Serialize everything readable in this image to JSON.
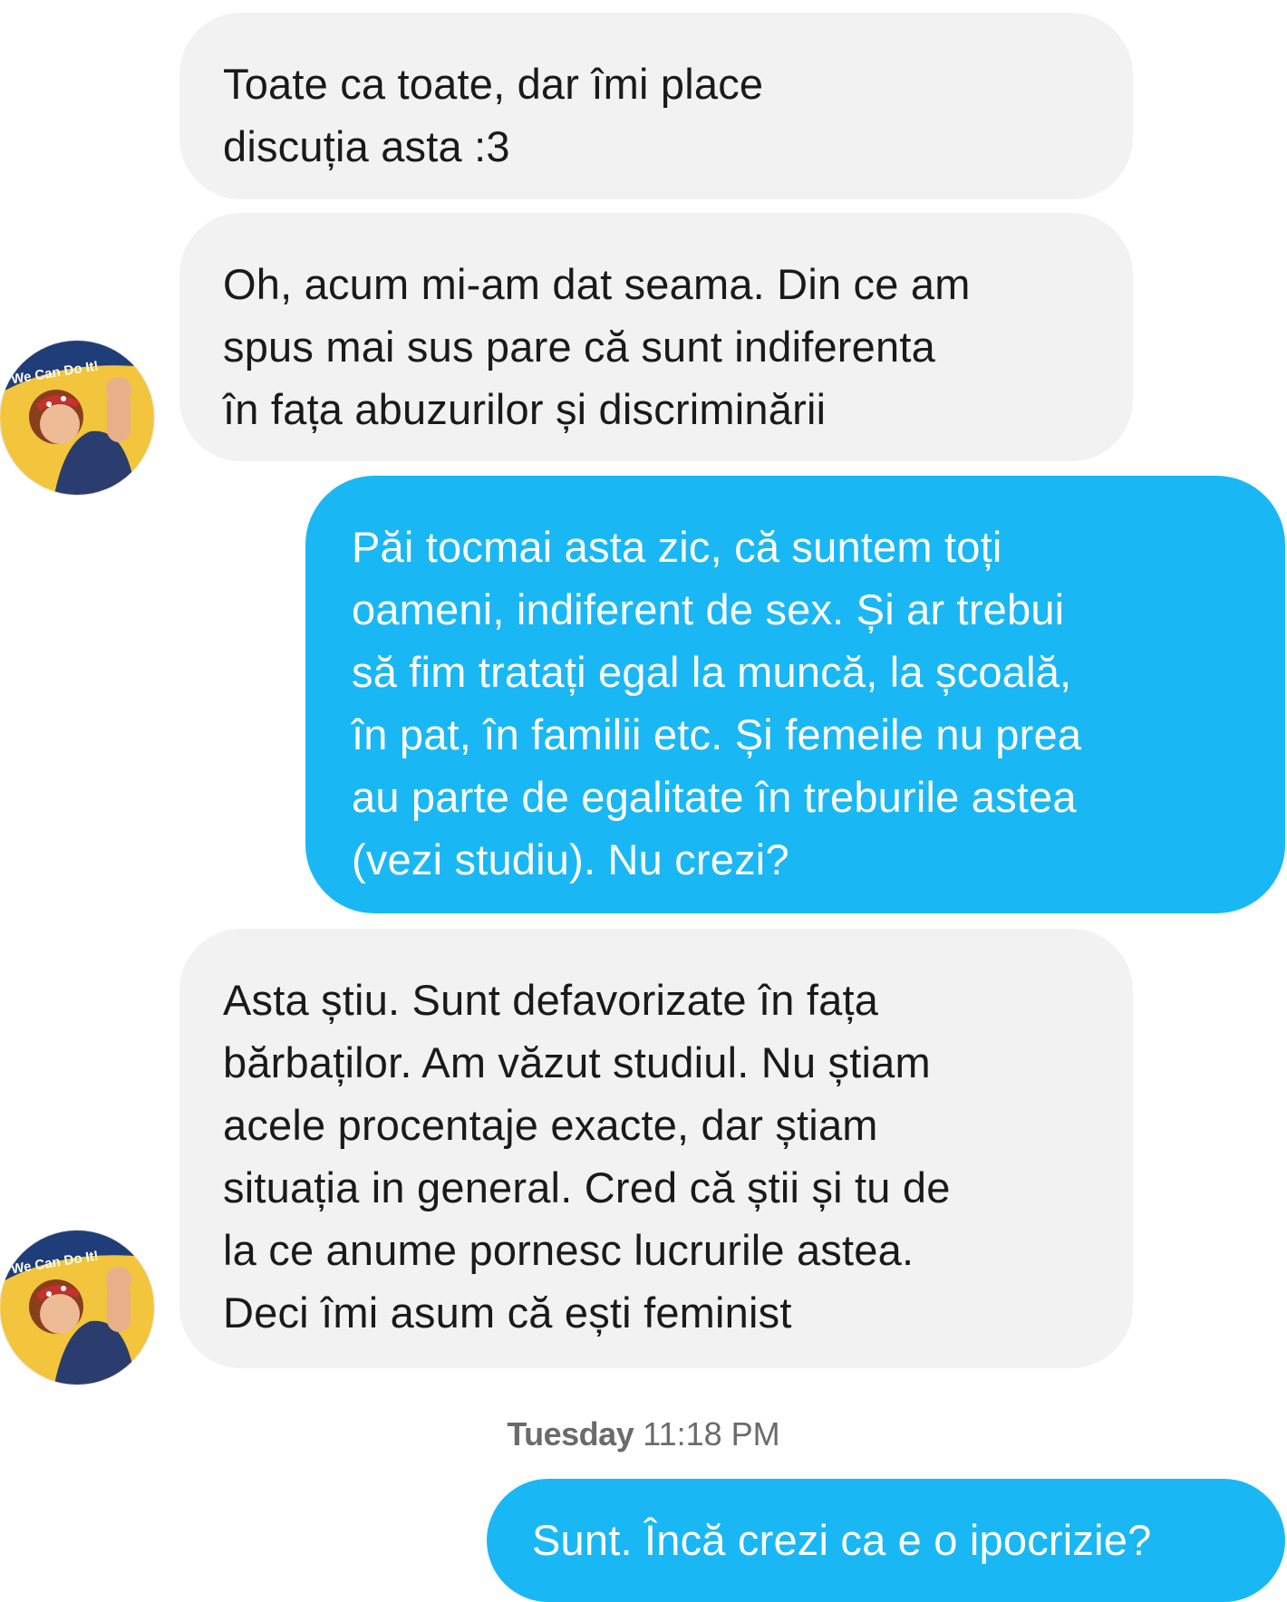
{
  "conversation": {
    "messages": [
      {
        "direction": "incoming",
        "text": "Toate ca toate, dar îmi place\ndiscuția asta :3"
      },
      {
        "direction": "incoming",
        "text": "Oh, acum mi-am dat seama. Din ce am\nspus mai sus pare că sunt indiferenta\nîn fața abuzurilor și discriminării"
      },
      {
        "direction": "outgoing",
        "text": "Păi tocmai asta zic, că suntem toți\noameni, indiferent de sex. Și ar trebui\nsă fim tratați egal la muncă, la școală,\nîn pat, în familii etc. Și femeile nu prea\nau parte de egalitate în treburile astea\n(vezi studiu). Nu crezi?"
      },
      {
        "direction": "incoming",
        "text": "Asta știu. Sunt defavorizate în fața\nbărbaților. Am văzut studiul. Nu știam\nacele procentaje exacte, dar știam\nsituația in general. Cred că știi și tu de\nla ce anume pornesc lucrurile astea.\nDeci îmi asum că ești feminist"
      },
      {
        "direction": "outgoing",
        "text": "Sunt. Încă crezi ca e o ipocrizie?"
      }
    ],
    "timestamp": {
      "day": "Tuesday",
      "time": "11:18 PM"
    },
    "avatar": {
      "icon": "we-can-do-it-poster-avatar",
      "caption": "We Can Do It!"
    }
  },
  "colors": {
    "incoming_bubble": "#f2f2f2",
    "outgoing_bubble": "#1ab7f5",
    "incoming_text": "#1a1a1a",
    "outgoing_text": "#ffffff",
    "timestamp_text": "#6b6b6b"
  }
}
